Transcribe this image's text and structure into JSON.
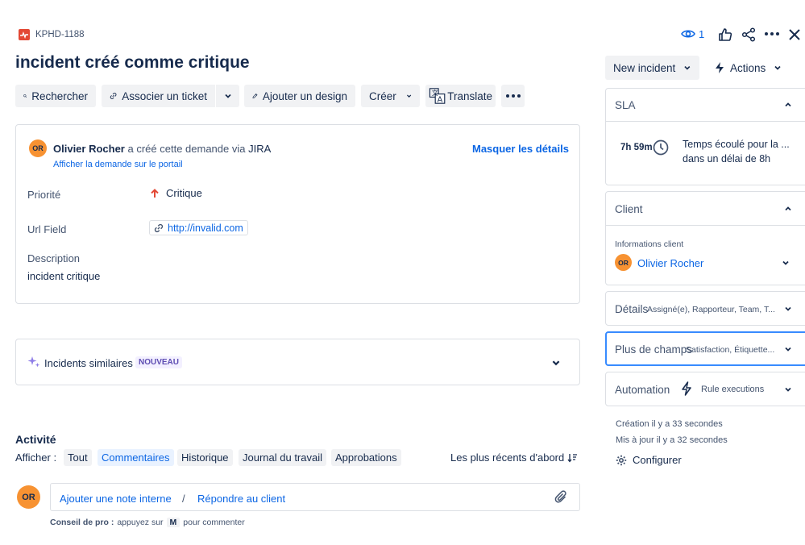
{
  "header": {
    "issue_key": "KPHD-1188",
    "watch_count": "1",
    "title": "incident créé comme critique"
  },
  "toolbar": {
    "search_label": "Rechercher",
    "link_ticket_label": "Associer un ticket",
    "add_design_label": "Ajouter un design",
    "create_label": "Créer",
    "translate_label": "Translate"
  },
  "request": {
    "author": "Olivier Rocher",
    "created_text": "a créé cette demande via",
    "channel": "JIRA",
    "portal_link": "Afficher la demande sur le portail",
    "hide_details": "Masquer les détails",
    "avatar_initials": "OR",
    "fields": {
      "priority_label": "Priorité",
      "priority_value": "Critique",
      "url_label": "Url Field",
      "url_value": "http://invalid.com",
      "description_label": "Description",
      "description_value": "incident critique"
    }
  },
  "similar": {
    "label": "Incidents similaires",
    "badge": "NOUVEAU"
  },
  "activity": {
    "title": "Activité",
    "show_label": "Afficher :",
    "tabs": [
      "Tout",
      "Commentaires",
      "Historique",
      "Journal du travail",
      "Approbations"
    ],
    "sort_label": "Les plus récents d'abord",
    "avatar_initials": "OR",
    "internal_note": "Ajouter une note interne",
    "separator": "/",
    "reply_client": "Répondre au client",
    "tip_prefix": "Conseil de pro :",
    "tip_press": "appuyez sur",
    "tip_key": "M",
    "tip_suffix": "pour commenter"
  },
  "sidebar": {
    "status_button": "New incident",
    "actions_button": "Actions",
    "sla": {
      "title": "SLA",
      "time": "7h 59m",
      "line1": "Temps écoulé pour la ...",
      "line2": "dans un délai de 8h"
    },
    "client": {
      "title": "Client",
      "info_label": "Informations client",
      "name": "Olivier Rocher",
      "avatar_initials": "OR"
    },
    "details": {
      "title": "Détails",
      "summary": "Assigné(e), Rapporteur, Team, T..."
    },
    "more_fields": {
      "title": "Plus de champs",
      "summary": "Satisfaction, Étiquette..."
    },
    "automation": {
      "title": "Automation",
      "rule": "Rule executions"
    },
    "created": "Création il y a 33 secondes",
    "updated": "Mis à jour il y a 32 secondes",
    "configure": "Configurer"
  },
  "colors": {
    "accent": "#0c66e4",
    "avatar": "#f79232",
    "priority": "#e34935",
    "issue_type": "#e34935",
    "badge_bg": "#f3f0ff",
    "badge_text": "#5e4db2"
  }
}
